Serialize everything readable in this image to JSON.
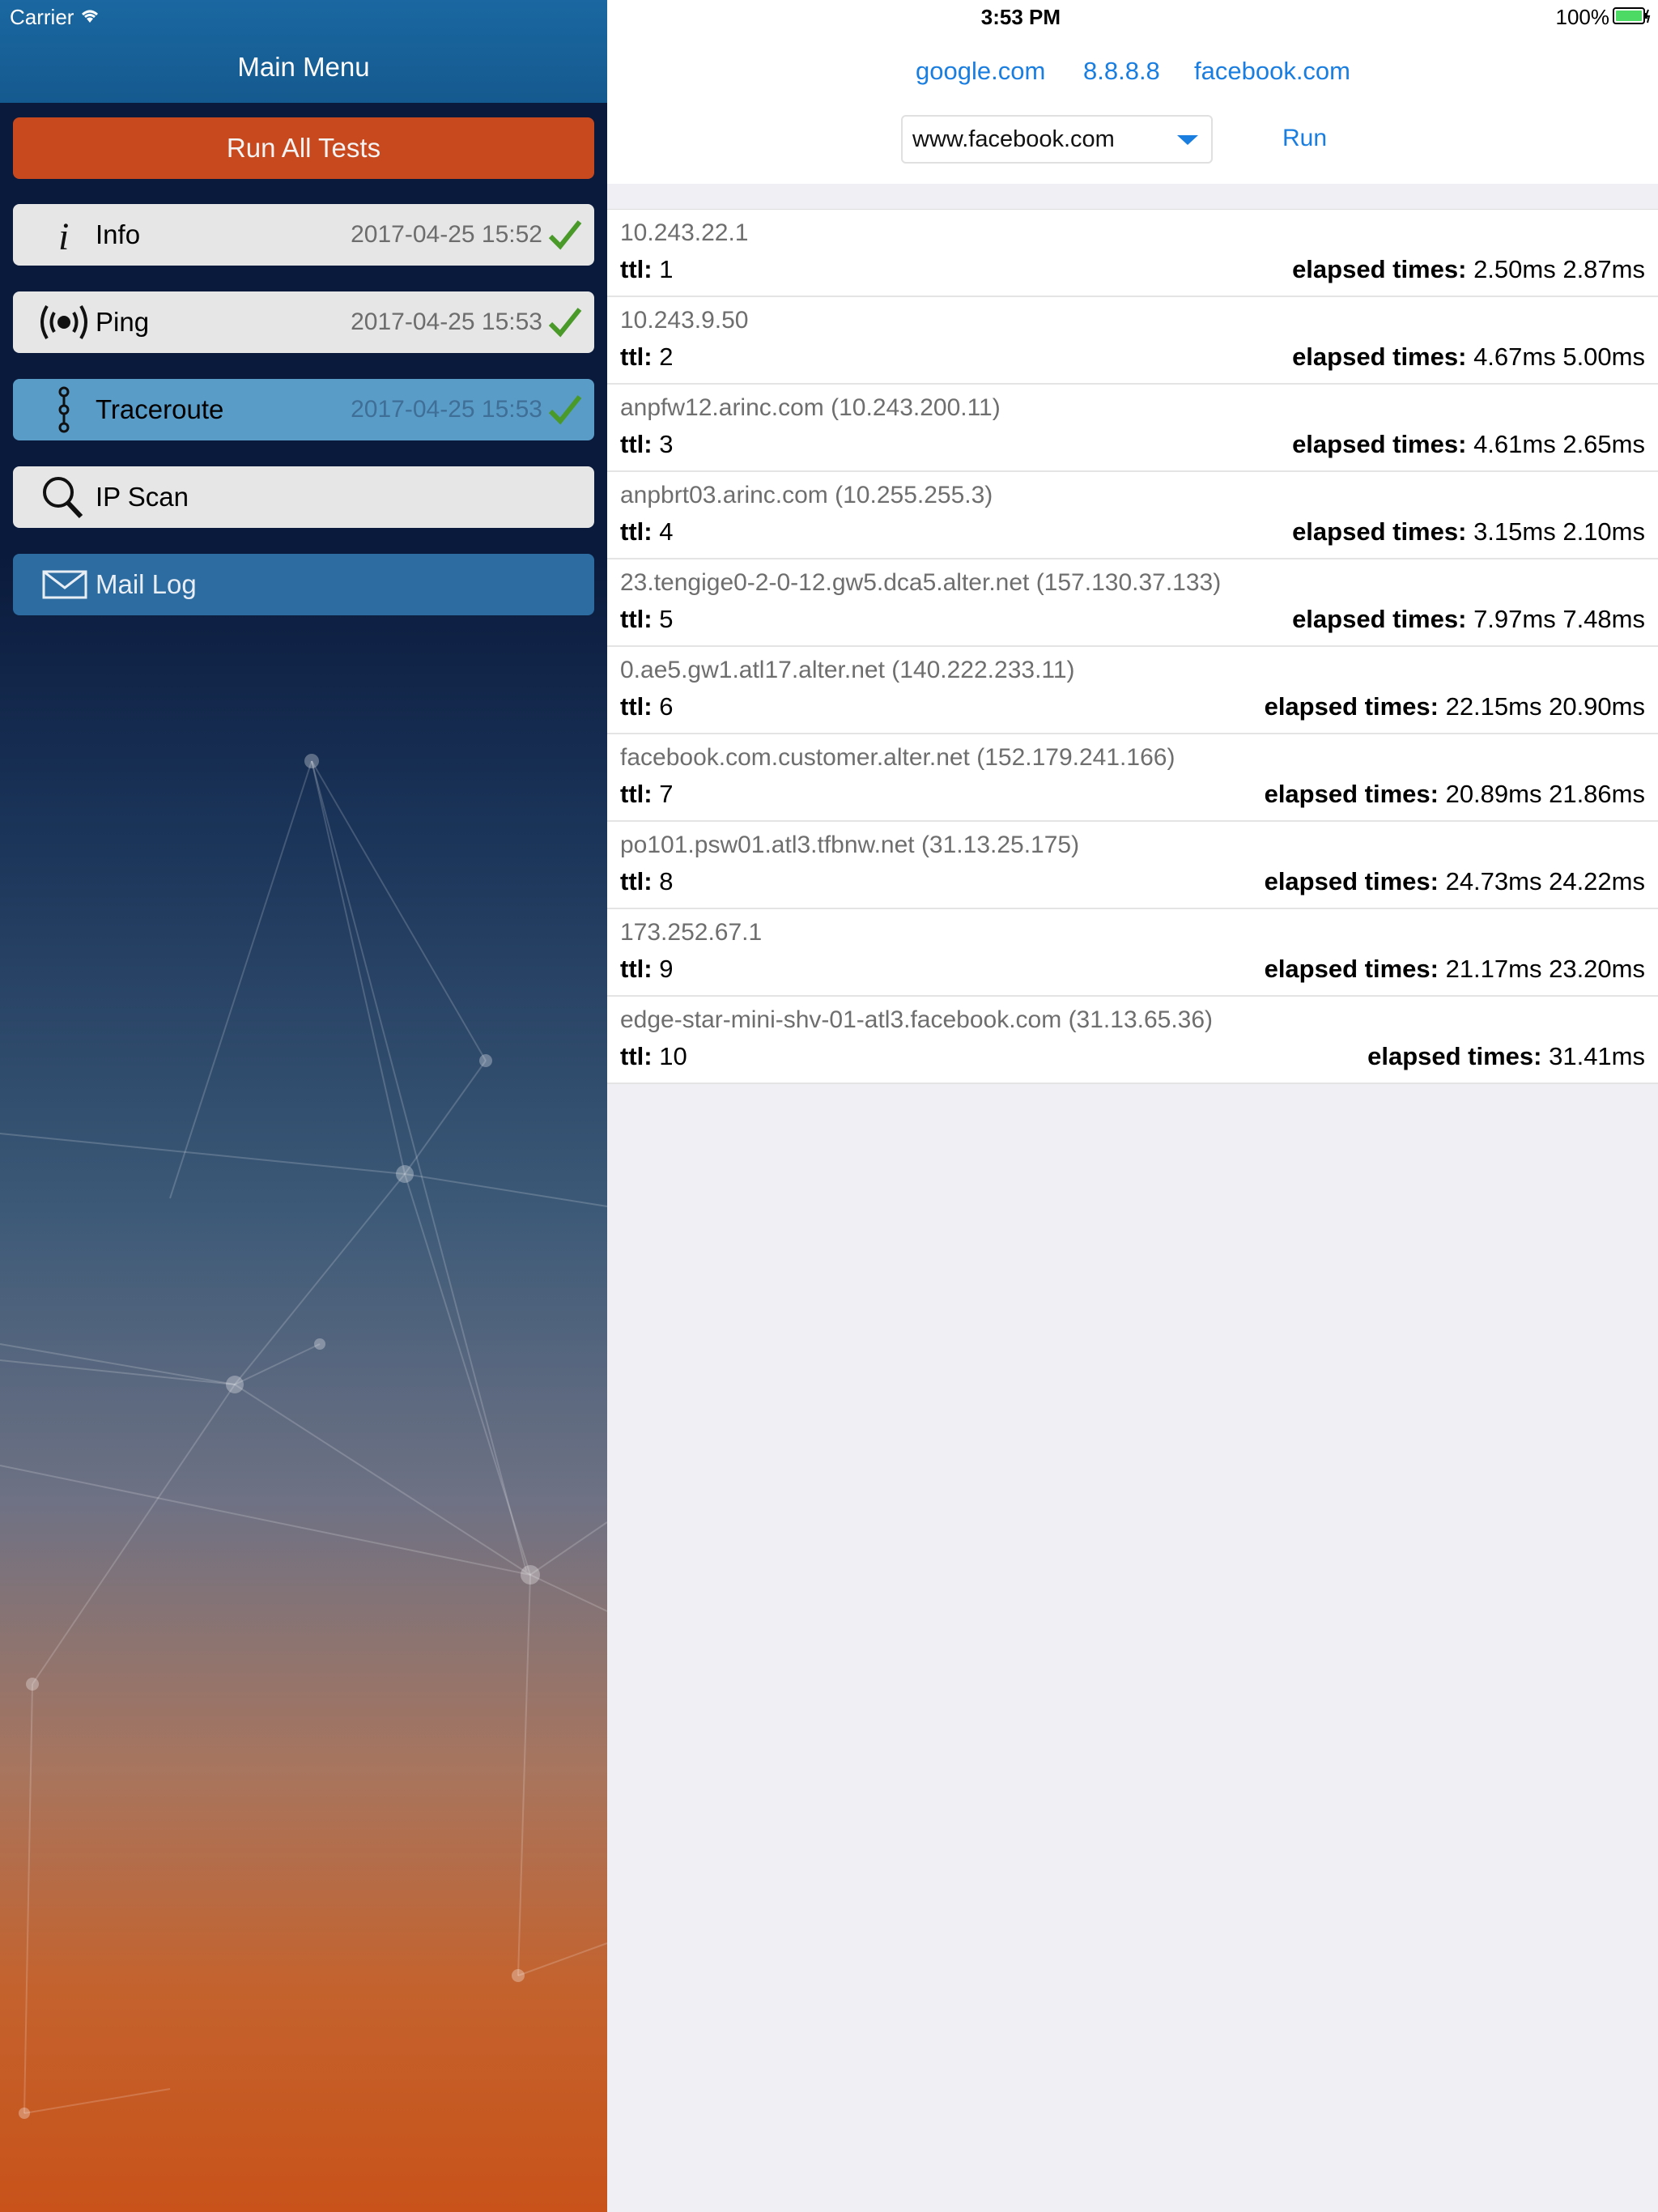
{
  "status_bar": {
    "carrier": "Carrier",
    "time": "3:53 PM",
    "battery": "100%"
  },
  "sidebar": {
    "title": "Main Menu",
    "run_all_label": "Run All Tests",
    "items": [
      {
        "label": "Info",
        "date": "2017-04-25 15:52",
        "icon": "info-icon"
      },
      {
        "label": "Ping",
        "date": "2017-04-25 15:53",
        "icon": "broadcast-icon"
      },
      {
        "label": "Traceroute",
        "date": "2017-04-25 15:53",
        "icon": "traceroute-icon"
      },
      {
        "label": "IP Scan",
        "date": "",
        "icon": "search-icon"
      },
      {
        "label": "Mail Log",
        "date": "",
        "icon": "mail-icon"
      }
    ]
  },
  "toolbar": {
    "quick_hosts": [
      "google.com",
      "8.8.8.8",
      "facebook.com"
    ],
    "selected_host": "www.facebook.com",
    "run_label": "Run"
  },
  "results": {
    "ttl_label": "ttl:",
    "elapsed_label": "elapsed times:",
    "rows": [
      {
        "host": "10.243.22.1",
        "ttl": "1",
        "times": "2.50ms 2.87ms"
      },
      {
        "host": "10.243.9.50",
        "ttl": "2",
        "times": "4.67ms 5.00ms"
      },
      {
        "host": "anpfw12.arinc.com (10.243.200.11)",
        "ttl": "3",
        "times": "4.61ms 2.65ms"
      },
      {
        "host": "anpbrt03.arinc.com (10.255.255.3)",
        "ttl": "4",
        "times": "3.15ms 2.10ms"
      },
      {
        "host": "23.tengige0-2-0-12.gw5.dca5.alter.net (157.130.37.133)",
        "ttl": "5",
        "times": "7.97ms 7.48ms"
      },
      {
        "host": "0.ae5.gw1.atl17.alter.net (140.222.233.11)",
        "ttl": "6",
        "times": "22.15ms 20.90ms"
      },
      {
        "host": "facebook.com.customer.alter.net (152.179.241.166)",
        "ttl": "7",
        "times": "20.89ms 21.86ms"
      },
      {
        "host": "po101.psw01.atl3.tfbnw.net (31.13.25.175)",
        "ttl": "8",
        "times": "24.73ms 24.22ms"
      },
      {
        "host": "173.252.67.1",
        "ttl": "9",
        "times": "21.17ms 23.20ms"
      },
      {
        "host": "edge-star-mini-shv-01-atl3.facebook.com (31.13.65.36)",
        "ttl": "10",
        "times": "31.41ms"
      }
    ]
  },
  "colors": {
    "accent": "#1a7ee0",
    "run_all": "#c8491e",
    "header": "#155a8f",
    "check": "#4a9a2a",
    "selected_item": "#5a9cc8",
    "mail_item": "#2c6ca1"
  }
}
